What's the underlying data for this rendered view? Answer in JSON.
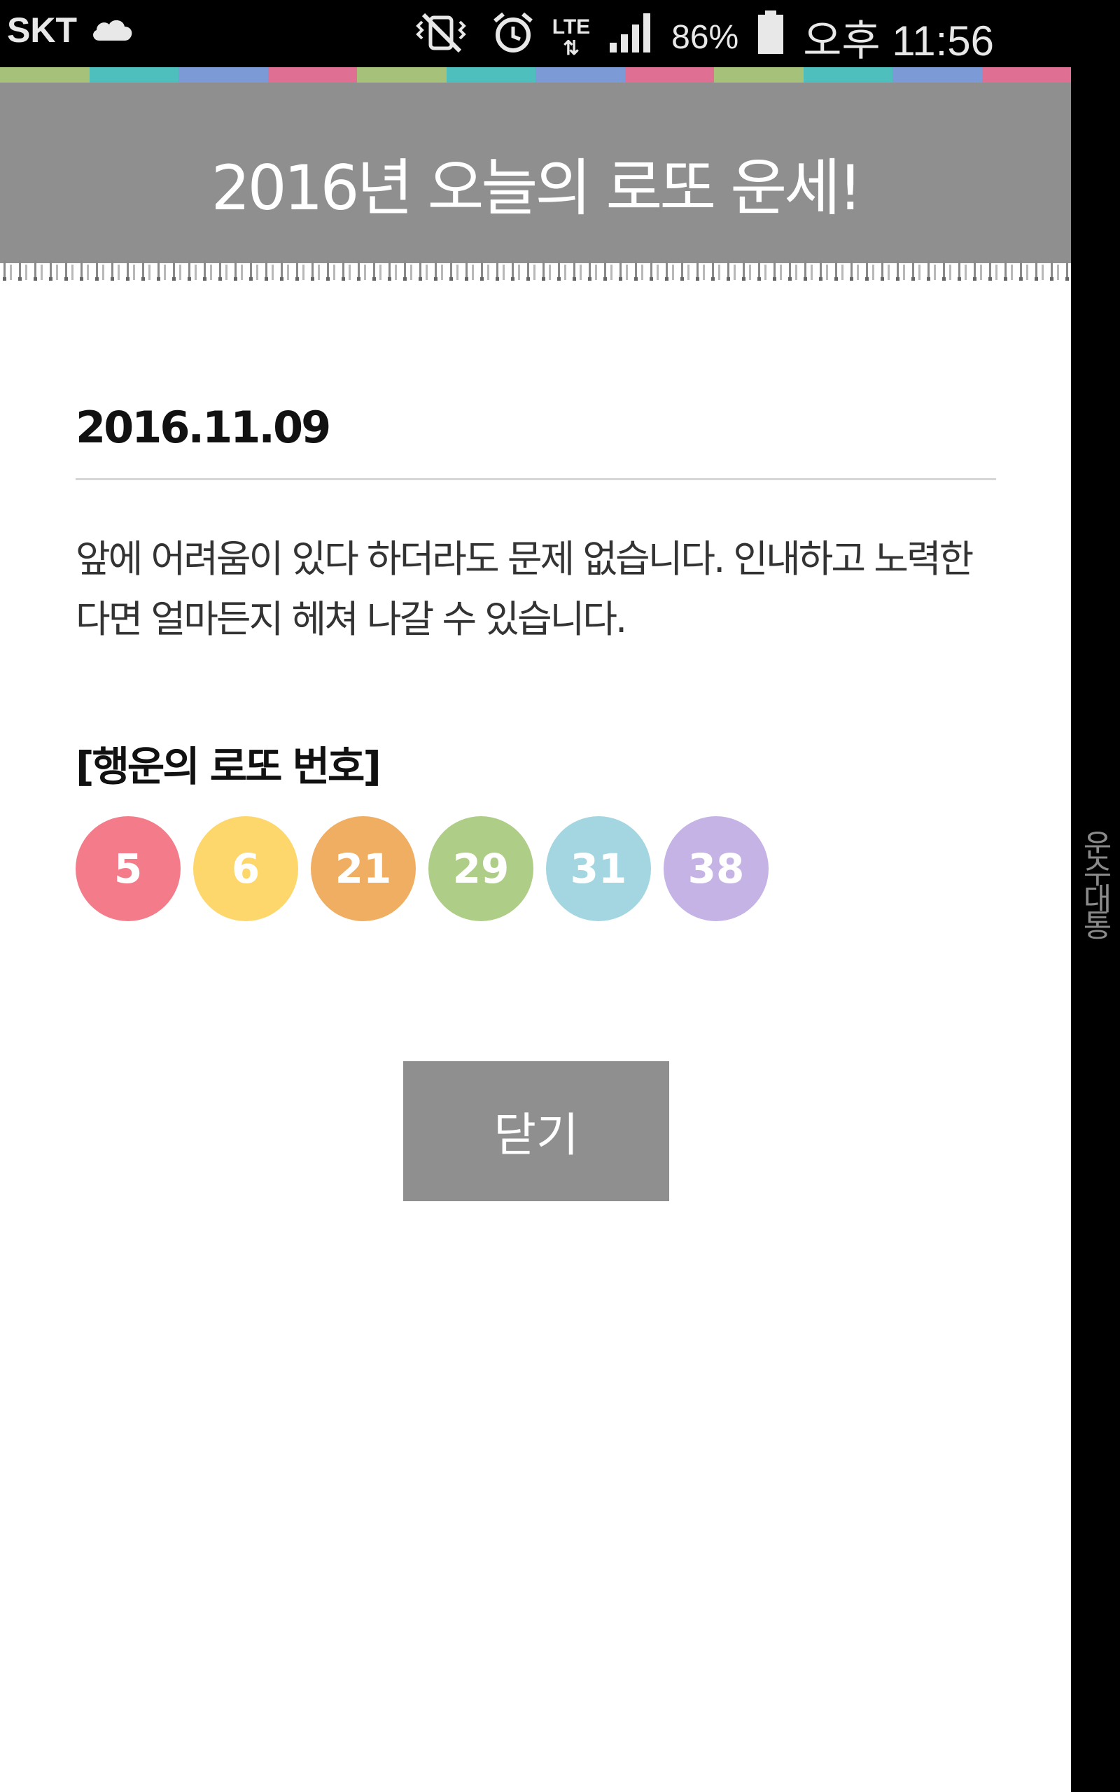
{
  "status_bar": {
    "carrier": "SKT",
    "network": "LTE",
    "battery": "86%",
    "time": "오후 11:56",
    "icons": [
      "cloud-icon",
      "vibrate-mute-icon",
      "alarm-icon",
      "lte-data-icon",
      "signal-icon",
      "battery-icon"
    ]
  },
  "header": {
    "title": "2016년 오늘의 로또 운세!",
    "stripe_colors": [
      "#a6c27a",
      "#4fbfbd",
      "#7b9ad6",
      "#e07093",
      "#a6c27a",
      "#4fbfbd",
      "#7b9ad6",
      "#e07093",
      "#a6c27a",
      "#4fbfbd",
      "#7b9ad6",
      "#e07093"
    ]
  },
  "content": {
    "date": "2016.11.09",
    "fortune": "앞에 어려움이 있다 하더라도 문제 없습니다. 인내하고 노력한다면 얼마든지 헤쳐 나갈 수 있습니다.",
    "lucky_title": "[행운의 로또 번호]",
    "numbers": [
      {
        "value": "5",
        "color": "#f47c8a"
      },
      {
        "value": "6",
        "color": "#fdd76b"
      },
      {
        "value": "21",
        "color": "#f0ae62"
      },
      {
        "value": "29",
        "color": "#aecd86"
      },
      {
        "value": "31",
        "color": "#a3d6e0"
      },
      {
        "value": "38",
        "color": "#c5b3e6"
      }
    ]
  },
  "close_button": "닫기",
  "side_label": "운수대통"
}
